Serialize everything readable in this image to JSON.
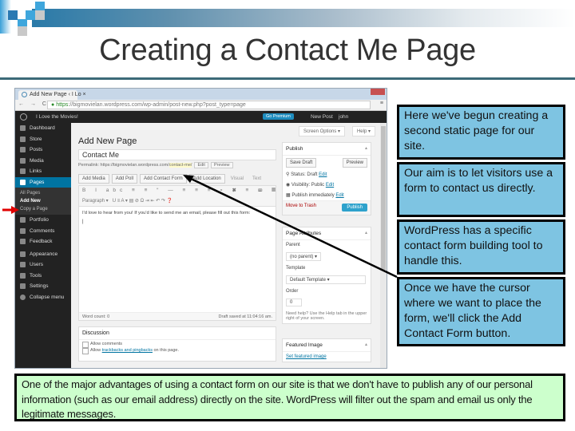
{
  "slide": {
    "title": "Creating a Contact Me Page"
  },
  "browser": {
    "tab_title": "Add New Page ‹ I Lo ×",
    "url_scheme": "https",
    "url_rest": "://bigmovielan.wordpress.com/wp-admin/post-new.php?post_type=page",
    "nav_icons": "← → C",
    "menu_icon": "≡"
  },
  "wp_admin_bar": {
    "site_name": "I Love the Movies!",
    "premium_button": "Go Premium",
    "new_post": "New Post",
    "user": "john"
  },
  "sidebar": {
    "items": [
      {
        "label": "Dashboard",
        "icon": "dashboard-icon"
      },
      {
        "label": "Store",
        "icon": "cart-icon"
      },
      {
        "label": "Posts",
        "icon": "pin-icon"
      },
      {
        "label": "Media",
        "icon": "media-icon"
      },
      {
        "label": "Links",
        "icon": "link-icon"
      },
      {
        "label": "Pages",
        "icon": "pages-icon",
        "active": true
      },
      {
        "label": "Portfolio",
        "icon": "portfolio-icon"
      },
      {
        "label": "Comments",
        "icon": "comments-icon"
      },
      {
        "label": "Feedback",
        "icon": "feedback-icon"
      },
      {
        "label": "Appearance",
        "icon": "appearance-icon"
      },
      {
        "label": "Users",
        "icon": "users-icon"
      },
      {
        "label": "Tools",
        "icon": "tools-icon"
      },
      {
        "label": "Settings",
        "icon": "settings-icon"
      },
      {
        "label": "Collapse menu",
        "icon": "collapse-icon"
      }
    ],
    "pages_submenu": [
      "All Pages",
      "Add New",
      "Copy a Page"
    ]
  },
  "editor": {
    "screen_options": "Screen Options ▾",
    "help": "Help ▾",
    "heading": "Add New Page",
    "title_value": "Contact Me",
    "permalink_label": "Permalink: https://bigmovielan.wordpress.com/",
    "permalink_slug": "contact-me/",
    "edit_button": "Edit",
    "preview_button": "Preview",
    "media_buttons": [
      "Add Media",
      "Add Poll",
      "Add Contact Form",
      "Add Location"
    ],
    "view_tabs": [
      "Visual",
      "Text"
    ],
    "toolbar1": "B I abc ≡ ≡ “ — ≡ ≡ ≡ ⌕ ✖ ≡ ⌨ ▦",
    "format_select": "Paragraph ▾",
    "toolbar2": "U ≡ A ▾ ▤ ⊘ Ω ⇥ ⇤ ↶ ↷ ❓",
    "body_text": "I'd love to hear from you! If you'd like to send me an email, please fill out this form:",
    "caret": "|",
    "word_count": "Word count: 0",
    "draft_saved": "Draft saved at 11:04:16 am."
  },
  "discussion": {
    "heading": "Discussion",
    "allow_comments": "Allow comments",
    "allow_prefix": "Allow ",
    "trackbacks_link": "trackbacks and pingbacks",
    "allow_suffix": " on this page."
  },
  "publish": {
    "heading": "Publish",
    "save_draft": "Save Draft",
    "preview": "Preview",
    "status": "Status: Draft",
    "visibility": "Visibility: Public",
    "schedule": "Publish immediately",
    "edit": "Edit",
    "trash": "Move to Trash",
    "publish": "Publish"
  },
  "page_attributes": {
    "heading": "Page Attributes",
    "parent_label": "Parent",
    "parent_value": "(no parent) ▾",
    "template_label": "Template",
    "template_value": "Default Template ▾",
    "order_label": "Order",
    "order_value": "0",
    "help_text": "Need help? Use the Help tab in the upper right of your screen."
  },
  "featured_image": {
    "heading": "Featured Image",
    "link": "Set featured image"
  },
  "callouts": [
    "Here we've begun creating a second static page for our site.",
    "Our aim is to let visitors use a form to contact us directly.",
    "WordPress has a specific contact form building tool to handle this.",
    "Once we have the cursor where we want to place the form, we'll click the Add Contact Form button."
  ],
  "bottom_note": "One of the major advantages of using a contact form on our site is that we don't have to publish any of our personal information (such as our email address) directly on the site.  WordPress will filter out the spam and email us only the legitimate messages.",
  "colors": {
    "callout_bg": "#7ec4e2",
    "note_bg": "#ccffcc",
    "wp_active": "#0074a2",
    "publish_btn": "#2ea2cc",
    "red_arrow": "#e00000"
  }
}
